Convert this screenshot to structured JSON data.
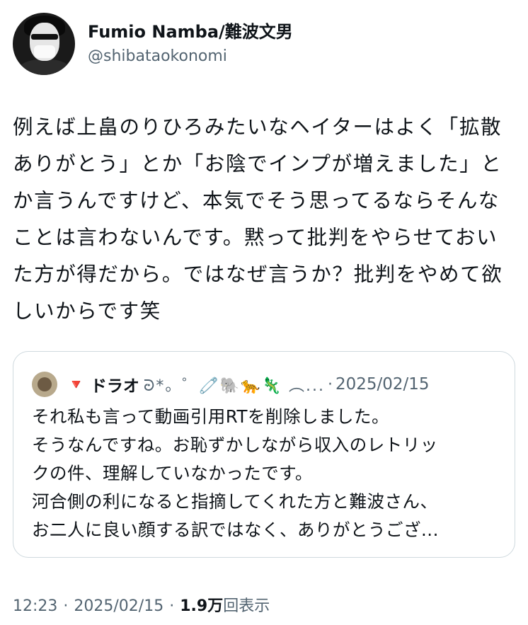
{
  "author": {
    "display_name": "Fumio Namba/難波文男",
    "handle": "@shibataokonomi"
  },
  "tweet_text": "例えば上畠のりひろみたいなヘイターはよく「拡散ありがとう」とか「お陰でインプが増えました」とか言うんですけど、本気でそう思ってるならそんなことは言わないんです。黙って批判をやらせておいた方が得だから。ではなぜ言うか？批判をやめて欲しいからです笑",
  "quote": {
    "marker": "🔻",
    "name": "ドラオ",
    "decorations": "ᘒ*。゜🧷🐘🐆🦎 ︵...",
    "separator": "·",
    "date": "2025/02/15",
    "lines": [
      "それ私も言って動画引用RTを削除しました。",
      "そうなんですね。お恥ずかしながら収入のレトリッ",
      "クの件、理解していなかったです。",
      "河合側の利になると指摘してくれた方と難波さん、",
      "お二人に良い顔する訳ではなく、ありがとうござ..."
    ]
  },
  "meta": {
    "time": "12:23",
    "date": "2025/02/15",
    "separator": "·",
    "views_count": "1.9万",
    "views_label": "回表示"
  }
}
